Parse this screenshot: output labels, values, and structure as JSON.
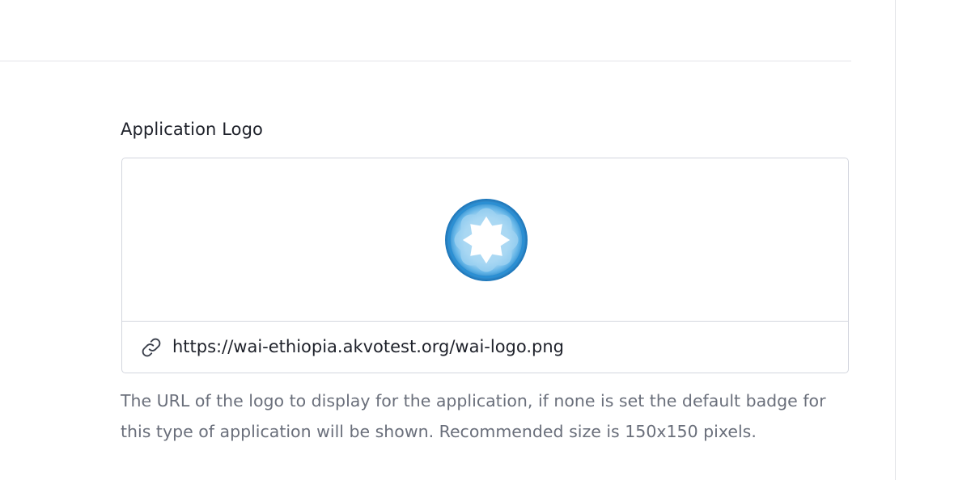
{
  "field": {
    "label": "Application Logo",
    "url_value": "https://wai-ethiopia.akvotest.org/wai-logo.png",
    "help_text": "The URL of the logo to display for the application, if none is set the default badge for this type of application will be shown. Recommended size is 150x150 pixels."
  },
  "icons": {
    "url_icon": "link-icon",
    "preview_icon": "wai-logo"
  },
  "colors": {
    "logo_dark_blue": "#1b7cc1",
    "logo_light_blue": "#9fd3f2",
    "border": "#d3d6de",
    "help_text": "#6a6f7b"
  }
}
